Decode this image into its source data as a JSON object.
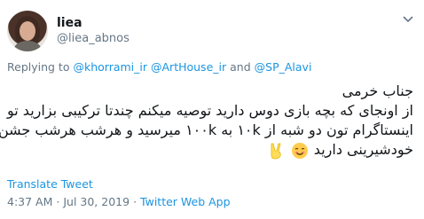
{
  "user": {
    "display_name": "liea",
    "handle": "@liea_abnos"
  },
  "reply": {
    "prefix": "Replying to",
    "mention1": "@khorrami_ir",
    "mention2": "@ArtHouse_ir",
    "conjunction": "and",
    "mention3": "@SP_Alavi"
  },
  "tweet": {
    "line1": "جناب خرمی",
    "line2": "از اونجای که بچه بازی دوس دارید توصیه میکنم چندتا ترکیبی بزارید تو",
    "line3": "اینستاگرام تون دو شبه از ۱۰k به ۱۰۰k میرسید و هرشب هرشب جشن",
    "line4": "خودشیرینی دارید",
    "emojis": [
      "smiling-face-icon",
      "victory-hand-icon"
    ]
  },
  "actions": {
    "translate": "Translate Tweet"
  },
  "meta": {
    "time": "4:37 AM",
    "separator1": "·",
    "date": "Jul 30, 2019",
    "separator2": "·",
    "source": "Twitter Web App"
  },
  "colors": {
    "link": "#1b95e0",
    "secondary_text": "#657786",
    "primary_text": "#14171a"
  }
}
